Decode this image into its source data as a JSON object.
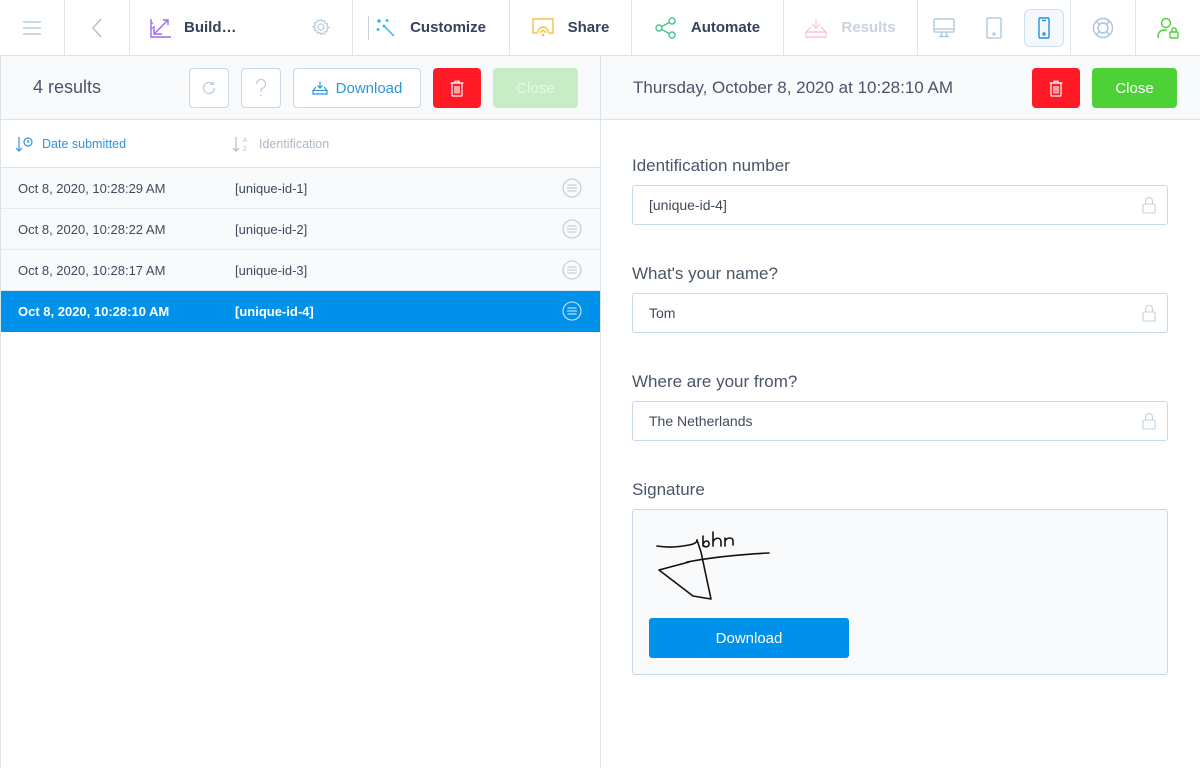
{
  "nav": {
    "build_label": "Build…",
    "customize_label": "Customize",
    "share_label": "Share",
    "automate_label": "Automate",
    "results_label": "Results",
    "colors": {
      "build": "#9b6cf0",
      "customize": "#26b6f0",
      "share": "#f5c242",
      "automate": "#4cc38a",
      "results_disabled": "#f9c9d0",
      "account": "#4cd137"
    }
  },
  "list": {
    "results_count": "4 results",
    "download_label": "Download",
    "close_label": "Close",
    "columns": {
      "date": "Date submitted",
      "identification": "Identification"
    },
    "rows": [
      {
        "date": "Oct 8, 2020, 10:28:29 AM",
        "id": "[unique-id-1]",
        "selected": false
      },
      {
        "date": "Oct 8, 2020, 10:28:22 AM",
        "id": "[unique-id-2]",
        "selected": false
      },
      {
        "date": "Oct 8, 2020, 10:28:17 AM",
        "id": "[unique-id-3]",
        "selected": false
      },
      {
        "date": "Oct 8, 2020, 10:28:10 AM",
        "id": "[unique-id-4]",
        "selected": true
      }
    ]
  },
  "detail": {
    "date": "Thursday, October 8, 2020 at 10:28:10 AM",
    "close_label": "Close",
    "fields": [
      {
        "label": "Identification number",
        "value": "[unique-id-4]"
      },
      {
        "label": "What's your name?",
        "value": "Tom"
      },
      {
        "label": "Where are your from?",
        "value": "The Netherlands"
      }
    ],
    "signature": {
      "label": "Signature",
      "download_label": "Download"
    }
  }
}
